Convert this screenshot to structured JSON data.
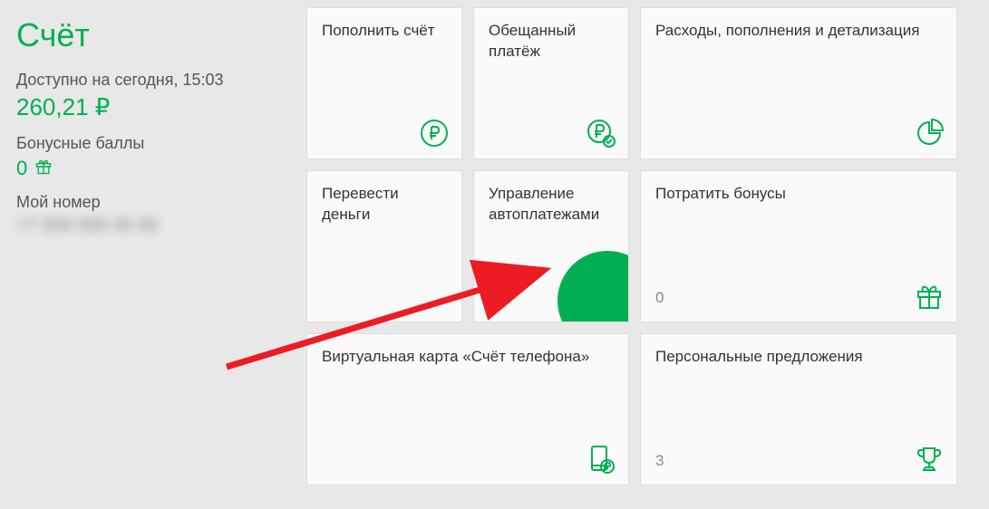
{
  "sidebar": {
    "title": "Счёт",
    "available_label": "Доступно на сегодня, 15:03",
    "balance": "260,21 ₽",
    "bonus_label": "Бонусные баллы",
    "bonus_value": "0",
    "my_number_label": "Мой номер",
    "phone_number": "+7 000 000 00 00"
  },
  "cards": {
    "topup": {
      "title": "Пополнить счёт"
    },
    "promised_payment": {
      "title": "Обещанный платёж"
    },
    "expenses": {
      "title": "Расходы, пополнения и детализация"
    },
    "transfer": {
      "title": "Перевести деньги"
    },
    "autopay": {
      "title": "Управление автоплатежами"
    },
    "spend_bonus": {
      "title": "Потратить бонусы",
      "value": "0"
    },
    "virtual_card": {
      "title": "Виртуальная карта «Счёт телефона»"
    },
    "personal_offers": {
      "title": "Персональные предложения",
      "value": "3"
    }
  }
}
